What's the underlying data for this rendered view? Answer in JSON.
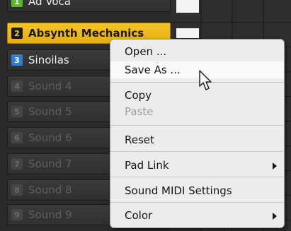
{
  "sound_list": {
    "items": [
      {
        "number": "1",
        "name": "Ad Voca",
        "state": "active",
        "num_color": "#5cb82e"
      },
      {
        "number": "2",
        "name": "Absynth Mechanics",
        "state": "selected",
        "num_color": "#1a1a1a"
      },
      {
        "number": "3",
        "name": "Sinoilas",
        "state": "active",
        "num_color": "#2f7fd1"
      },
      {
        "number": "4",
        "name": "Sound 4",
        "state": "empty",
        "num_color": "#454545"
      },
      {
        "number": "5",
        "name": "Sound 5",
        "state": "empty",
        "num_color": "#454545"
      },
      {
        "number": "6",
        "name": "Sound 6",
        "state": "empty",
        "num_color": "#454545"
      },
      {
        "number": "7",
        "name": "Sound 7",
        "state": "empty",
        "num_color": "#454545"
      },
      {
        "number": "8",
        "name": "Sound 8",
        "state": "empty",
        "num_color": "#454545"
      },
      {
        "number": "9",
        "name": "Sound 9",
        "state": "empty",
        "num_color": "#454545"
      }
    ],
    "selected_color": "#f2bd1e"
  },
  "context_menu": {
    "open_label": "Open ...",
    "save_as_label": "Save As ...",
    "copy_label": "Copy",
    "paste_label": "Paste",
    "reset_label": "Reset",
    "pad_link_label": "Pad Link",
    "sound_midi_settings_label": "Sound MIDI Settings",
    "color_label": "Color",
    "hovered_item": "Save As ...",
    "disabled_items": [
      "Paste"
    ],
    "submenu_items": [
      "Pad Link",
      "Color"
    ]
  },
  "icons": {
    "cursor": "mouse-pointer-icon",
    "submenu": "submenu-arrow-icon"
  }
}
